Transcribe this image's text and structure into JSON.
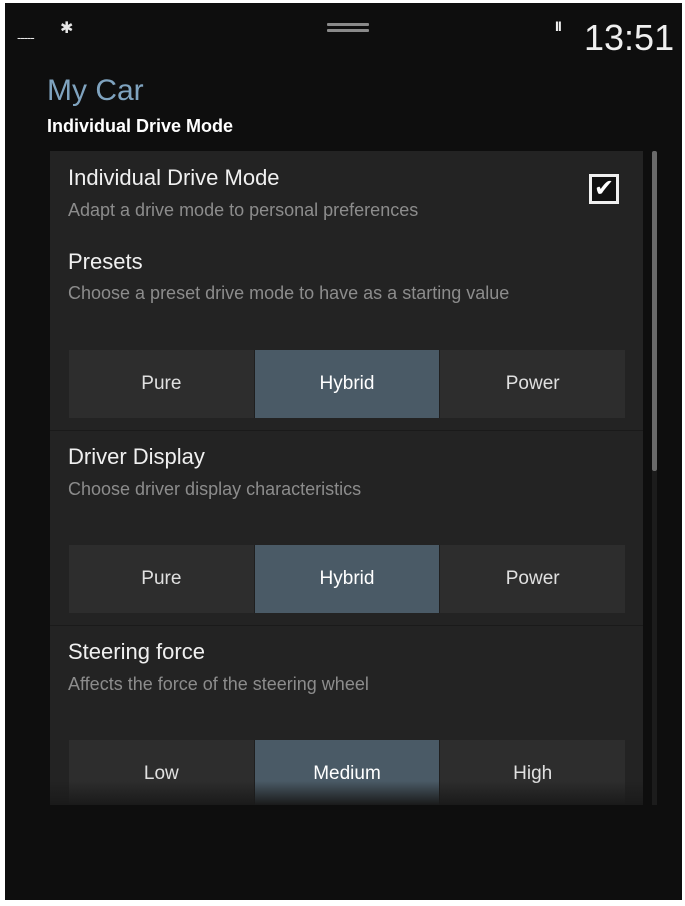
{
  "status": {
    "signal": "-----",
    "bluetooth_icon": "bluetooth-icon",
    "pause_icon": "pause-icon",
    "time": "13:51"
  },
  "header": {
    "title": "My Car",
    "subtitle": "Individual Drive Mode"
  },
  "settings": {
    "idm": {
      "title": "Individual Drive Mode",
      "desc": "Adapt a drive mode to personal preferences",
      "checked": true
    },
    "presets": {
      "title": "Presets",
      "desc": "Choose a preset drive mode to have as a starting value",
      "options": [
        "Pure",
        "Hybrid",
        "Power"
      ],
      "selected": "Hybrid"
    },
    "driver_display": {
      "title": "Driver Display",
      "desc": "Choose driver display characteristics",
      "options": [
        "Pure",
        "Hybrid",
        "Power"
      ],
      "selected": "Hybrid"
    },
    "steering": {
      "title": "Steering force",
      "desc": "Affects the force of the steering wheel",
      "options": [
        "Low",
        "Medium",
        "High"
      ],
      "selected": "Medium"
    }
  },
  "colors": {
    "accent_title": "#7fa3bf",
    "selected_segment": "#4a5a66",
    "panel": "#232323",
    "background": "#0e0e0e"
  }
}
